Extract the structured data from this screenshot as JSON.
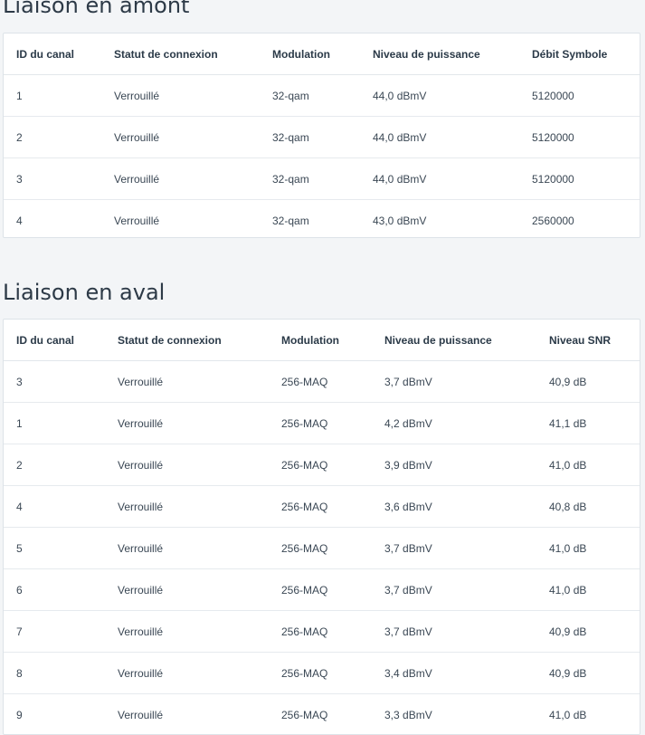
{
  "upstream": {
    "title": "Liaison en amont",
    "headers": [
      "ID du canal",
      "Statut de connexion",
      "Modulation",
      "Niveau de puissance",
      "Débit Symbole"
    ],
    "rows": [
      [
        "1",
        "Verrouillé",
        "32-qam",
        "44,0 dBmV",
        "5120000"
      ],
      [
        "2",
        "Verrouillé",
        "32-qam",
        "44,0 dBmV",
        "5120000"
      ],
      [
        "3",
        "Verrouillé",
        "32-qam",
        "44,0 dBmV",
        "5120000"
      ],
      [
        "4",
        "Verrouillé",
        "32-qam",
        "43,0 dBmV",
        "2560000"
      ]
    ]
  },
  "downstream": {
    "title": "Liaison en aval",
    "headers": [
      "ID du canal",
      "Statut de connexion",
      "Modulation",
      "Niveau de puissance",
      "Niveau SNR"
    ],
    "rows": [
      [
        "3",
        "Verrouillé",
        "256-MAQ",
        "3,7 dBmV",
        "40,9 dB"
      ],
      [
        "1",
        "Verrouillé",
        "256-MAQ",
        "4,2 dBmV",
        "41,1 dB"
      ],
      [
        "2",
        "Verrouillé",
        "256-MAQ",
        "3,9 dBmV",
        "41,0 dB"
      ],
      [
        "4",
        "Verrouillé",
        "256-MAQ",
        "3,6 dBmV",
        "40,8 dB"
      ],
      [
        "5",
        "Verrouillé",
        "256-MAQ",
        "3,7 dBmV",
        "41,0 dB"
      ],
      [
        "6",
        "Verrouillé",
        "256-MAQ",
        "3,7 dBmV",
        "41,0 dB"
      ],
      [
        "7",
        "Verrouillé",
        "256-MAQ",
        "3,7 dBmV",
        "40,9 dB"
      ],
      [
        "8",
        "Verrouillé",
        "256-MAQ",
        "3,4 dBmV",
        "40,9 dB"
      ],
      [
        "9",
        "Verrouillé",
        "256-MAQ",
        "3,3 dBmV",
        "41,0 dB"
      ]
    ]
  }
}
